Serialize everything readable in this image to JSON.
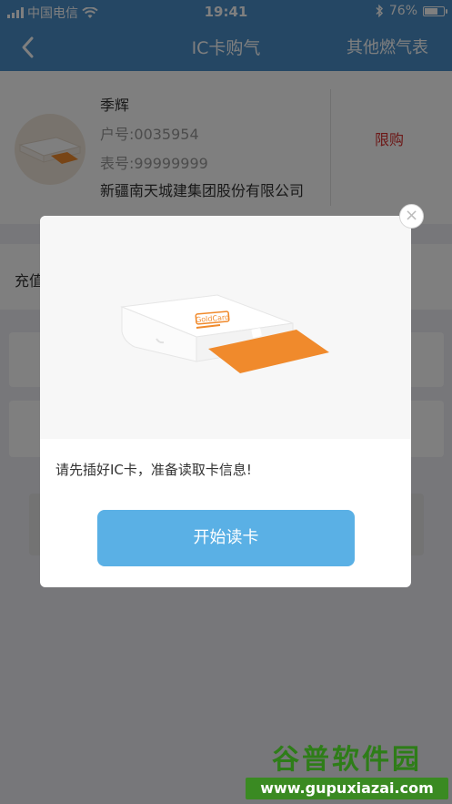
{
  "status_bar": {
    "carrier": "中国电信",
    "time": "19:41",
    "battery_text": "76%",
    "battery_level": 0.76
  },
  "nav": {
    "title": "IC卡购气",
    "right_link": "其他燃气表"
  },
  "user": {
    "name": "季辉",
    "account": "户号:0035954",
    "meter": "表号:99999999",
    "company": "新疆南天城建集团股份有限公司",
    "limit_label": "限购"
  },
  "recharge_label": "充值",
  "modal": {
    "message": "请先插好IC卡，准备读取卡信息!",
    "button_label": "开始读卡",
    "close_symbol": "×",
    "device_brand": "GoldCard"
  },
  "watermark": {
    "title": "谷普软件园",
    "url": "www.gupuxiazai.com"
  },
  "colors": {
    "header": "#4a8fc9",
    "button": "#5ab0e5",
    "limit": "#d9312f",
    "card_orange": "#f08a2c"
  }
}
